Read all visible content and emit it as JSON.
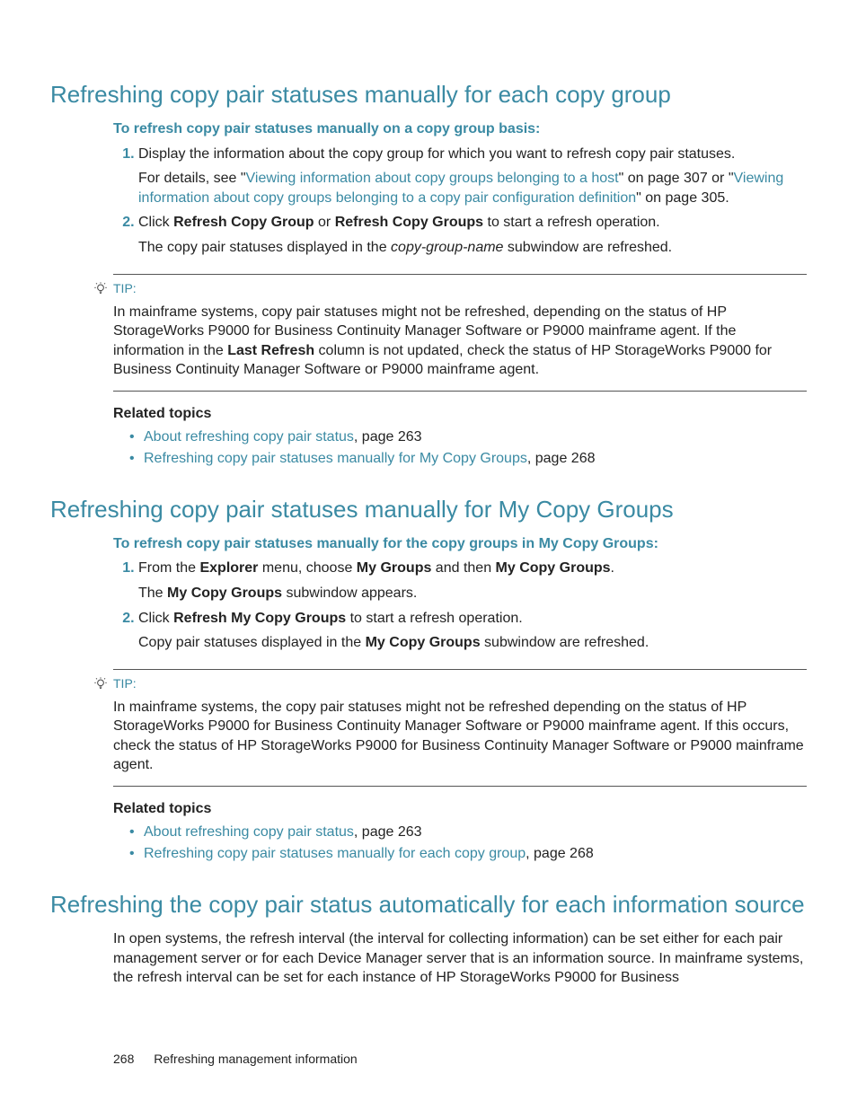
{
  "section1": {
    "heading": "Refreshing copy pair statuses manually for each copy group",
    "intro": "To refresh copy pair statuses manually on a copy group basis:",
    "step1": "Display the information about the copy group for which you want to refresh copy pair statuses.",
    "step1_detail_pre": "For details, see \"",
    "step1_link1": "Viewing information about copy groups belonging to a host",
    "step1_detail_mid": "\" on page 307 or \"",
    "step1_link2": "Viewing information about copy groups belonging to a copy pair configuration definition",
    "step1_detail_post": "\" on page 305.",
    "step2_pre": "Click ",
    "step2_b1": "Refresh Copy Group",
    "step2_mid": " or ",
    "step2_b2": "Refresh Copy Groups",
    "step2_post": " to start a refresh operation.",
    "step2_sub_pre": "The copy pair statuses displayed in the ",
    "step2_sub_i": "copy-group-name",
    "step2_sub_post": " subwindow are refreshed.",
    "tip_label": "TIP:",
    "tip_pre": "In mainframe systems, copy pair statuses might not be refreshed, depending on the status of HP StorageWorks P9000 for Business Continuity Manager Software or P9000 mainframe agent. If the information in the ",
    "tip_b": "Last Refresh",
    "tip_post": " column is not updated, check the status of HP StorageWorks P9000 for Business Continuity Manager Software or P9000 mainframe agent.",
    "related_heading": "Related topics",
    "related1_link": "About refreshing copy pair status",
    "related1_post": ", page 263",
    "related2_link": "Refreshing copy pair statuses manually for My Copy Groups",
    "related2_post": ", page 268"
  },
  "section2": {
    "heading": "Refreshing copy pair statuses manually for My Copy Groups",
    "intro": "To refresh copy pair statuses manually for the copy groups in My Copy Groups:",
    "step1_pre": "From the ",
    "step1_b1": "Explorer",
    "step1_mid1": " menu, choose ",
    "step1_b2": "My Groups",
    "step1_mid2": " and then ",
    "step1_b3": "My Copy Groups",
    "step1_post": ".",
    "step1_sub_pre": "The ",
    "step1_sub_b": "My Copy Groups",
    "step1_sub_post": " subwindow appears.",
    "step2_pre": "Click ",
    "step2_b": "Refresh My Copy Groups",
    "step2_post": " to start a refresh operation.",
    "step2_sub_pre": "Copy pair statuses displayed in the ",
    "step2_sub_b": "My Copy Groups",
    "step2_sub_post": " subwindow are refreshed.",
    "tip_label": "TIP:",
    "tip_text": "In mainframe systems, the copy pair statuses might not be refreshed depending on the status of HP StorageWorks P9000 for Business Continuity Manager Software or P9000 mainframe agent. If this occurs, check the status of HP StorageWorks P9000 for Business Continuity Manager Software or P9000 mainframe agent.",
    "related_heading": "Related topics",
    "related1_link": "About refreshing copy pair status",
    "related1_post": ", page 263",
    "related2_link": "Refreshing copy pair statuses manually for each copy group",
    "related2_post": ", page 268"
  },
  "section3": {
    "heading": "Refreshing the copy pair status automatically for each information source",
    "body": "In open systems, the refresh interval (the interval for collecting information) can be set either for each pair management server or for each Device Manager server that is an information source. In mainframe systems, the refresh interval can be set for each instance of HP StorageWorks P9000 for Business"
  },
  "footer": {
    "page": "268",
    "title": "Refreshing management information"
  }
}
